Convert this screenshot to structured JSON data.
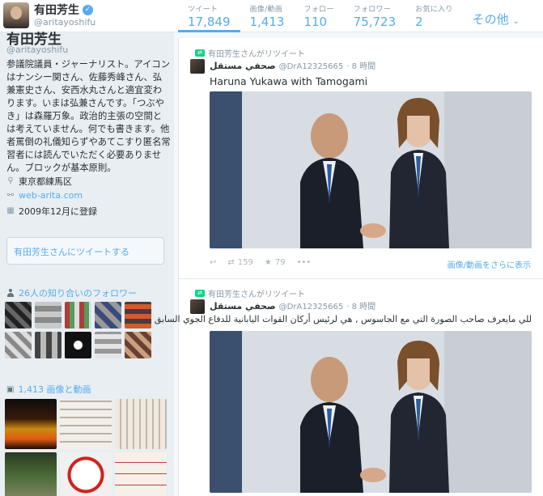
{
  "header": {
    "name": "有田芳生",
    "handle": "@aritayoshifu",
    "stats": [
      {
        "label": "ツイート",
        "value": "17,849"
      },
      {
        "label": "画像/動画",
        "value": "1,413"
      },
      {
        "label": "フォロー",
        "value": "110"
      },
      {
        "label": "フォロワー",
        "value": "75,723"
      },
      {
        "label": "お気に入り",
        "value": "2"
      }
    ],
    "more_label": "その他"
  },
  "profile": {
    "name": "有田芳生",
    "handle": "@aritayoshifu",
    "bio": "参議院議員・ジャーナリスト。アイコンはナンシー関さん、佐藤秀峰さん、弘兼憲史さん、安西水丸さんと適宜変わります。いまは弘兼さんです。「つぶやき」は森羅万象。政治的主張の空間とは考えていません。何でも書きます。他者罵倒の礼儀知らずやあてこすり匿名常習者には読んでいただく必要ありません。ブロックが基本原則。",
    "location": "東京都練馬区",
    "website": "web-arita.com",
    "joined": "2009年12月に登録",
    "tweet_to": "有田芳生さんにツイートする",
    "followers_you_know": "26人の知り合いのフォロワー",
    "media_count": "1,413 画像と動画"
  },
  "tweets": [
    {
      "retweet_label": "有田芳生さんがリツイート",
      "author": "صحفي مستقل",
      "handle": "@DrA12325665",
      "time": "· 8 時間",
      "text": "Haruna Yukawa with Tamogami",
      "retweets": "159",
      "favorites": "79",
      "more_media": "画像/動画をさらに表示"
    },
    {
      "retweet_label": "有田芳生さんがリツイート",
      "author": "صحفي مستقل",
      "handle": "@DrA12325665",
      "time": "· 8 時間",
      "text": "للي مايعرف صاحب الصورة التي مع الجاسوس , هي لرئيس أركان القوات اليابانية للدفاع الجوي السابق"
    }
  ],
  "colors": {
    "accent": "#55acee",
    "retweet_green": "#19cf86"
  }
}
